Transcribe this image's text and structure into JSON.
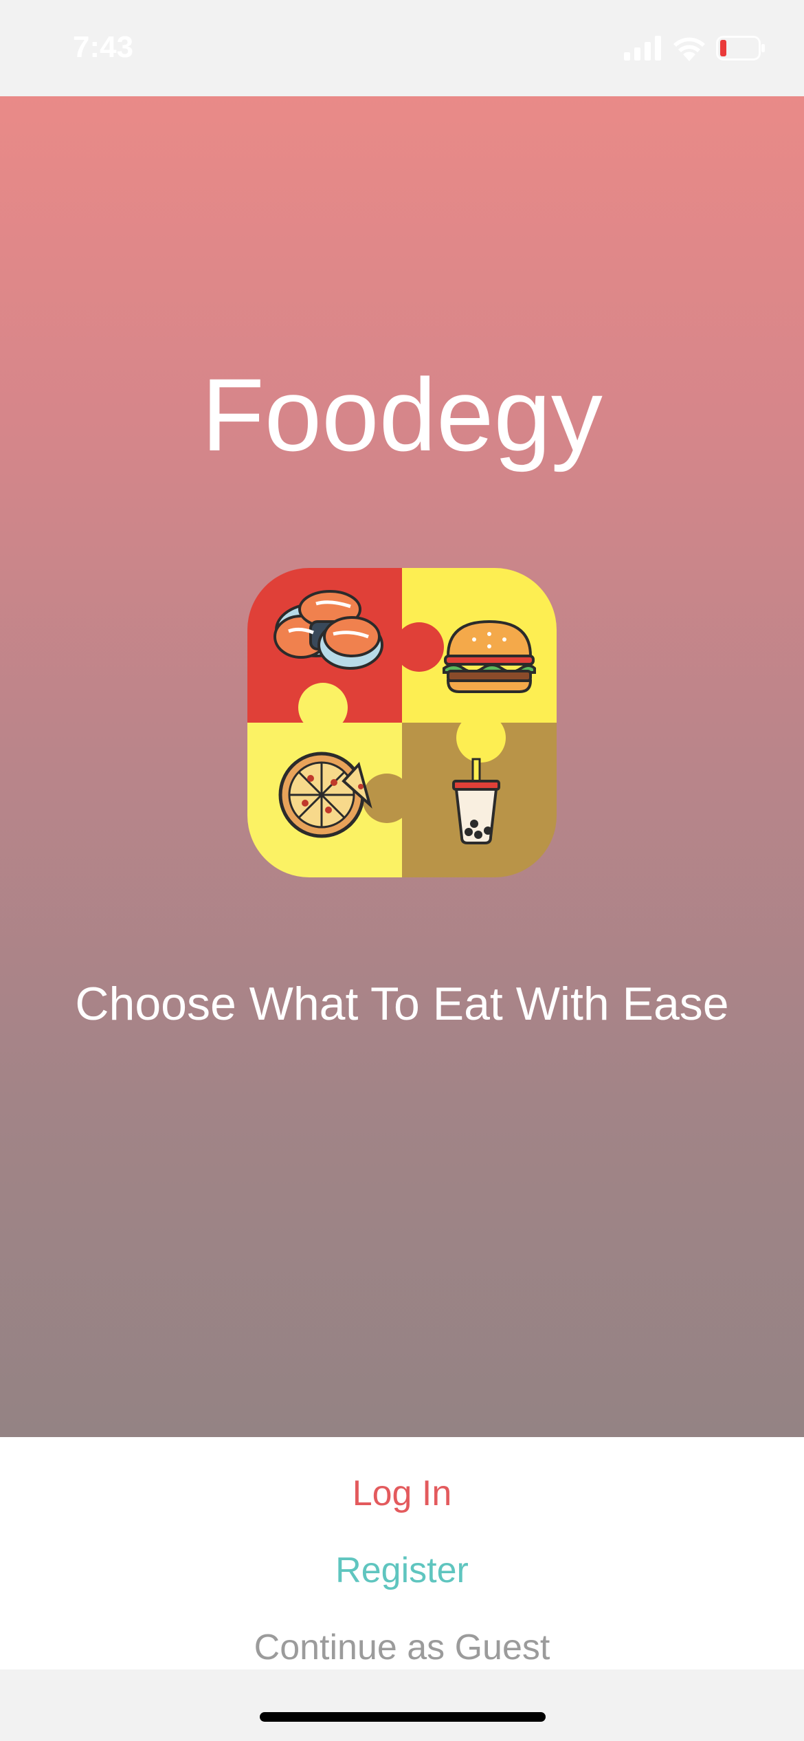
{
  "status_bar": {
    "time": "7:43",
    "icons": [
      "cellular-signal-icon",
      "wifi-icon",
      "battery-low-icon"
    ]
  },
  "hero": {
    "title": "Foodegy",
    "tagline": "Choose What To Eat With Ease",
    "logo": {
      "tiles": [
        "sushi-icon",
        "burger-icon",
        "pizza-icon",
        "bubble-tea-icon"
      ],
      "colors": {
        "red": "#e04038",
        "yellow": "#fdee52",
        "light_yellow": "#fbf264",
        "gold": "#b99448"
      }
    }
  },
  "actions": {
    "login": "Log In",
    "register": "Register",
    "guest": "Continue as Guest"
  },
  "colors": {
    "login": "#e35a5d",
    "register": "#5fc5bf",
    "guest": "#9b9b9b",
    "gradient_top": "#e98a88",
    "gradient_bottom": "#948384"
  }
}
